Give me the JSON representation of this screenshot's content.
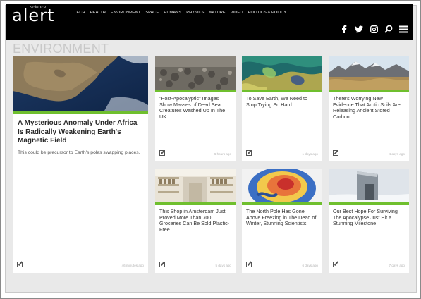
{
  "header": {
    "logo_sup": "science",
    "logo_main": "alert",
    "nav": [
      "TECH",
      "HEALTH",
      "ENVIRONMENT",
      "SPACE",
      "HUMANS",
      "PHYSICS",
      "NATURE",
      "VIDEO",
      "POLITICS & POLICY"
    ],
    "icons": [
      "facebook-icon",
      "twitter-icon",
      "instagram-icon",
      "search-icon",
      "menu-icon"
    ]
  },
  "section_title": "ENVIRONMENT",
  "featured": {
    "title": "A Mysterious Anomaly Under Africa Is Radically Weakening Earth's Magnetic Field",
    "snippet": "This could be precursor to Earth's poles swapping places.",
    "time": "46 minutes ago"
  },
  "articles": [
    {
      "title": "\"Post-Apocalyptic\" Images Show Masses of Dead Sea Creatures Washed Up In The UK",
      "time": "6 hours ago"
    },
    {
      "title": "To Save Earth, We Need to Stop Trying So Hard",
      "time": "1 days ago"
    },
    {
      "title": "There's Worrying New Evidence That Arctic Soils Are Releasing Ancient Stored Carbon",
      "time": "4 days ago"
    },
    {
      "title": "This Shop in Amsterdam Just Proved More Than 700 Groceries Can Be Sold Plastic-Free",
      "time": "5 days ago"
    },
    {
      "title": "The North Pole Has Gone Above Freezing in The Dead of Winter, Stunning Scientists",
      "time": "6 days ago"
    },
    {
      "title": "Our Best Hope For Surviving The Apocalypse Just Hit a Stunning Milestone",
      "time": "7 days ago"
    }
  ],
  "colors": {
    "header_bg": "#000000",
    "accent_green": "#6fbf2e",
    "page_bg": "#e9e9e9"
  }
}
